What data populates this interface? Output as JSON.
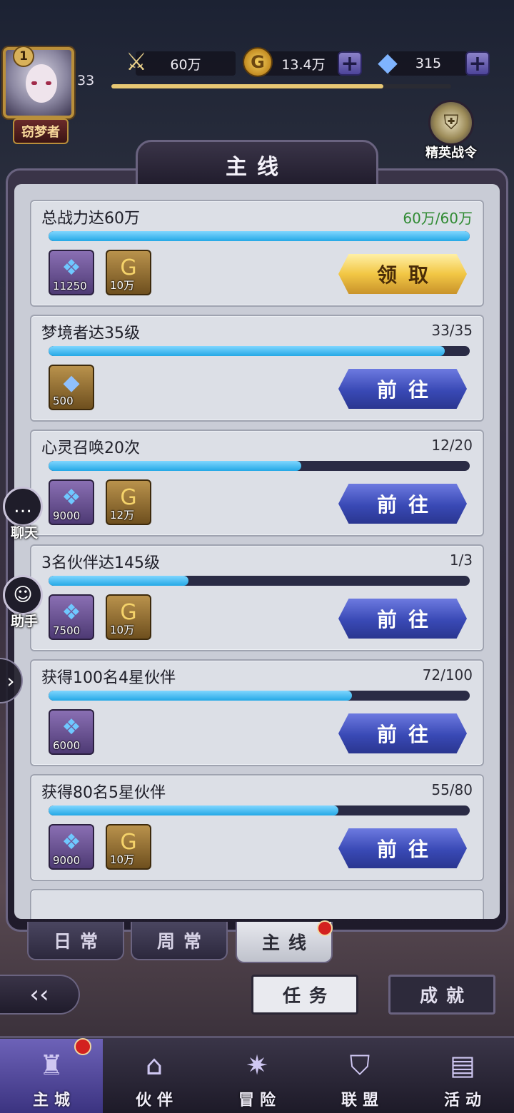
{
  "hud": {
    "player_level": "33",
    "avatar_rank": "1",
    "title_tag": "窃梦者",
    "power": "60万",
    "gold": "13.4万",
    "gems": "315",
    "exp_progress": 0.8,
    "elite_pass_label": "精英战令"
  },
  "panel": {
    "title": "主线"
  },
  "quests": [
    {
      "name": "总战力达60万",
      "progress": "60万/60万",
      "fraction": 1.0,
      "completed": true,
      "rewards": [
        {
          "type": "crystal",
          "amount": "11250"
        },
        {
          "type": "coin",
          "amount": "10万"
        }
      ],
      "button": "领取"
    },
    {
      "name": "梦境者达35级",
      "progress": "33/35",
      "fraction": 0.94,
      "completed": false,
      "rewards": [
        {
          "type": "diamond",
          "amount": "500"
        }
      ],
      "button": "前往"
    },
    {
      "name": "心灵召唤20次",
      "progress": "12/20",
      "fraction": 0.6,
      "completed": false,
      "rewards": [
        {
          "type": "crystal",
          "amount": "9000"
        },
        {
          "type": "coin",
          "amount": "12万"
        }
      ],
      "button": "前往"
    },
    {
      "name": "3名伙伴达145级",
      "progress": "1/3",
      "fraction": 0.333,
      "completed": false,
      "rewards": [
        {
          "type": "crystal",
          "amount": "7500"
        },
        {
          "type": "coin",
          "amount": "10万"
        }
      ],
      "button": "前往"
    },
    {
      "name": "获得100名4星伙伴",
      "progress": "72/100",
      "fraction": 0.72,
      "completed": false,
      "rewards": [
        {
          "type": "crystal",
          "amount": "6000"
        }
      ],
      "button": "前往"
    },
    {
      "name": "获得80名5星伙伴",
      "progress": "55/80",
      "fraction": 0.6875,
      "completed": false,
      "rewards": [
        {
          "type": "crystal",
          "amount": "9000"
        },
        {
          "type": "coin",
          "amount": "10万"
        }
      ],
      "button": "前往"
    }
  ],
  "tabs": {
    "daily": "日常",
    "weekly": "周常",
    "main": "主线"
  },
  "buttons": {
    "tasks": "任务",
    "achievements": "成就"
  },
  "side": {
    "chat": "聊天",
    "helper": "助手"
  },
  "nav": [
    {
      "label": "主城",
      "icon": "castle-icon"
    },
    {
      "label": "伙伴",
      "icon": "witch-hat-icon"
    },
    {
      "label": "冒险",
      "icon": "compass-icon"
    },
    {
      "label": "联盟",
      "icon": "shield-icon"
    },
    {
      "label": "活动",
      "icon": "cards-icon"
    }
  ],
  "colors": {
    "accent_blue": "#24a8e6",
    "claim_gold": "#f2c745",
    "go_blue": "#3949b5",
    "done_green": "#2f8a32",
    "alert_red": "#d3211f"
  }
}
